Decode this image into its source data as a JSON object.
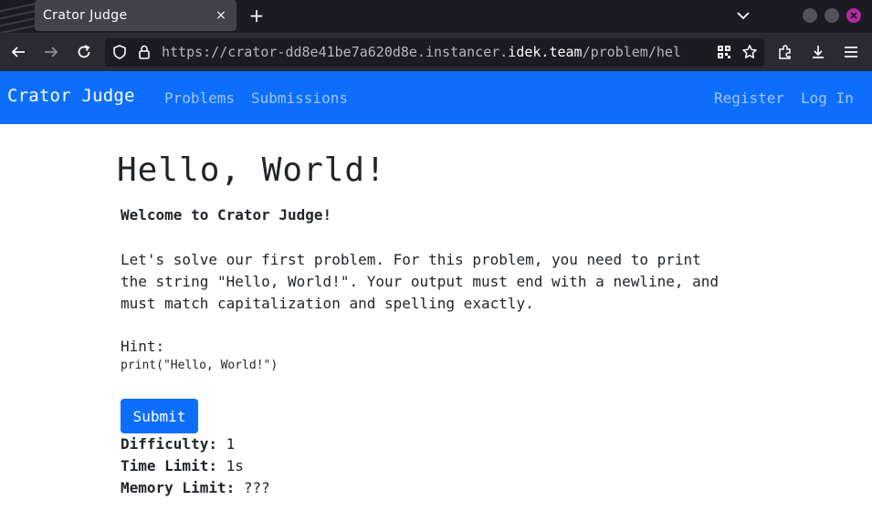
{
  "browser": {
    "tab_title": "Crator Judge",
    "tab_close": "×",
    "new_tab": "+",
    "url_prefix": "https://crator-dd8e41be7a620d8e.instancer.",
    "url_host": "idek.team",
    "url_path": "/problem/hel",
    "colors": {
      "tabbar": "#1c1b22",
      "toolbar": "#2b2a33",
      "close_button": "#b02aa0"
    }
  },
  "site": {
    "brand": "Crator Judge",
    "nav_left": [
      "Problems",
      "Submissions"
    ],
    "nav_right": [
      "Register",
      "Log In"
    ],
    "accent_color": "#0d6efd"
  },
  "problem": {
    "title": "Hello, World!",
    "welcome": "Welcome to Crator Judge!",
    "description": "Let's solve our first problem. For this problem, you need to print\nthe string \"Hello, World!\". Your output must end with a newline, and\nmust match capitalization and spelling exactly.",
    "hint_label": "Hint:",
    "hint_code": "print(\"Hello, World!\")",
    "submit_label": "Submit",
    "difficulty_label": "Difficulty:",
    "difficulty_value": "1",
    "time_limit_label": "Time Limit:",
    "time_limit_value": "1s",
    "memory_limit_label": "Memory Limit:",
    "memory_limit_value": "???"
  }
}
